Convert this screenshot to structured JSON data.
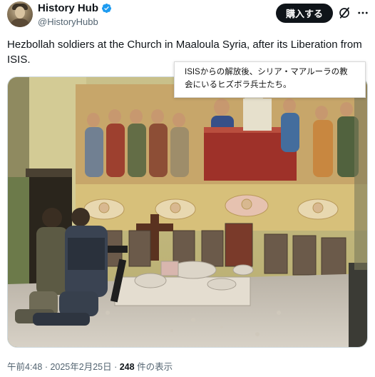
{
  "account": {
    "display_name": "History Hub",
    "handle": "@HistoryHubb",
    "verified": true,
    "avatar_icon": "avatar-portrait"
  },
  "actions": {
    "buy_label": "購入する",
    "grok_icon": "grok-slash-icon",
    "more_icon": "more-dots-icon"
  },
  "tweet": {
    "text": "Hezbollah soldiers at the Church in Maaloula Syria, after its Liberation from ISIS."
  },
  "translation_popup": {
    "text": "ISISからの解放後、シリア・マアルーラの教会にいるヒズボラ兵士たち。"
  },
  "meta": {
    "time": "午前4:48",
    "sep1": " · ",
    "date": "2025年2月25日",
    "sep2": " · ",
    "views_count": "248",
    "views_label": " 件の表示"
  },
  "colors": {
    "accent_blue": "#1d9bf0",
    "button_black": "#0f1419",
    "secondary_text": "#536471"
  }
}
